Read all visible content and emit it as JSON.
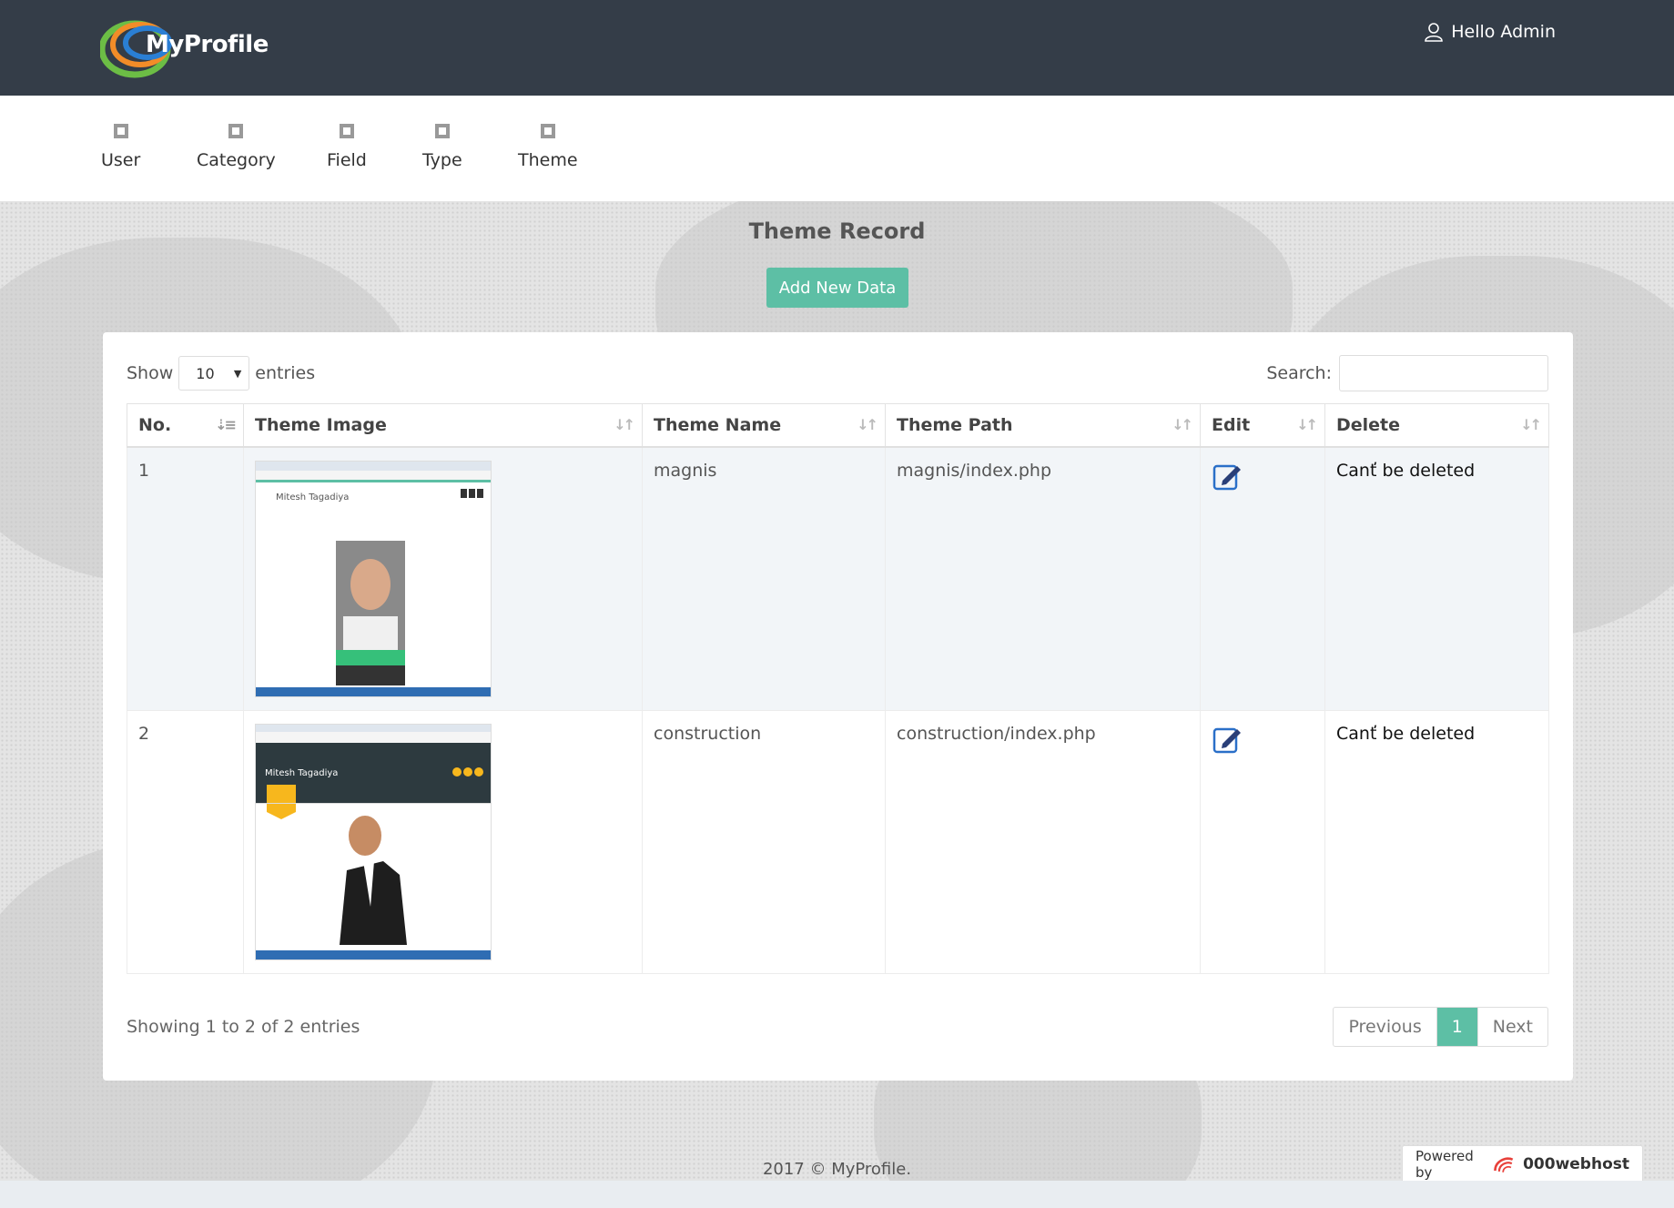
{
  "header": {
    "logo_text": "MyProfile",
    "user_greeting": "Hello Admin"
  },
  "nav": {
    "items": [
      {
        "label": "User",
        "icon": "expand-icon"
      },
      {
        "label": "Category",
        "icon": "expand-icon"
      },
      {
        "label": "Field",
        "icon": "expand-icon"
      },
      {
        "label": "Type",
        "icon": "expand-icon"
      },
      {
        "label": "Theme",
        "icon": "expand-icon"
      }
    ]
  },
  "page": {
    "title": "Theme Record",
    "add_button": "Add New Data"
  },
  "table_controls": {
    "show_label": "Show",
    "page_length": "10",
    "entries_label": "entries",
    "search_label": "Search:",
    "search_value": ""
  },
  "table": {
    "columns": [
      "No.",
      "Theme Image",
      "Theme Name",
      "Theme Path",
      "Edit",
      "Delete"
    ],
    "rows": [
      {
        "no": "1",
        "name": "magnis",
        "path": "magnis/index.php",
        "delete": "Canť be deleted"
      },
      {
        "no": "2",
        "name": "construction",
        "path": "construction/index.php",
        "delete": "Canť be deleted"
      }
    ],
    "thumb_texts": {
      "magnis_name": "Mitesh Tagadiya",
      "construction_name": "Mitesh Tagadiya"
    }
  },
  "pagination": {
    "info": "Showing 1 to 2 of 2 entries",
    "previous": "Previous",
    "current": "1",
    "next": "Next"
  },
  "footer": {
    "copyright": "2017 © MyProfile.",
    "powered_by": "Powered by",
    "host_brand": "000webhost"
  },
  "colors": {
    "header_bg": "#343d48",
    "accent": "#5dbfa5"
  }
}
